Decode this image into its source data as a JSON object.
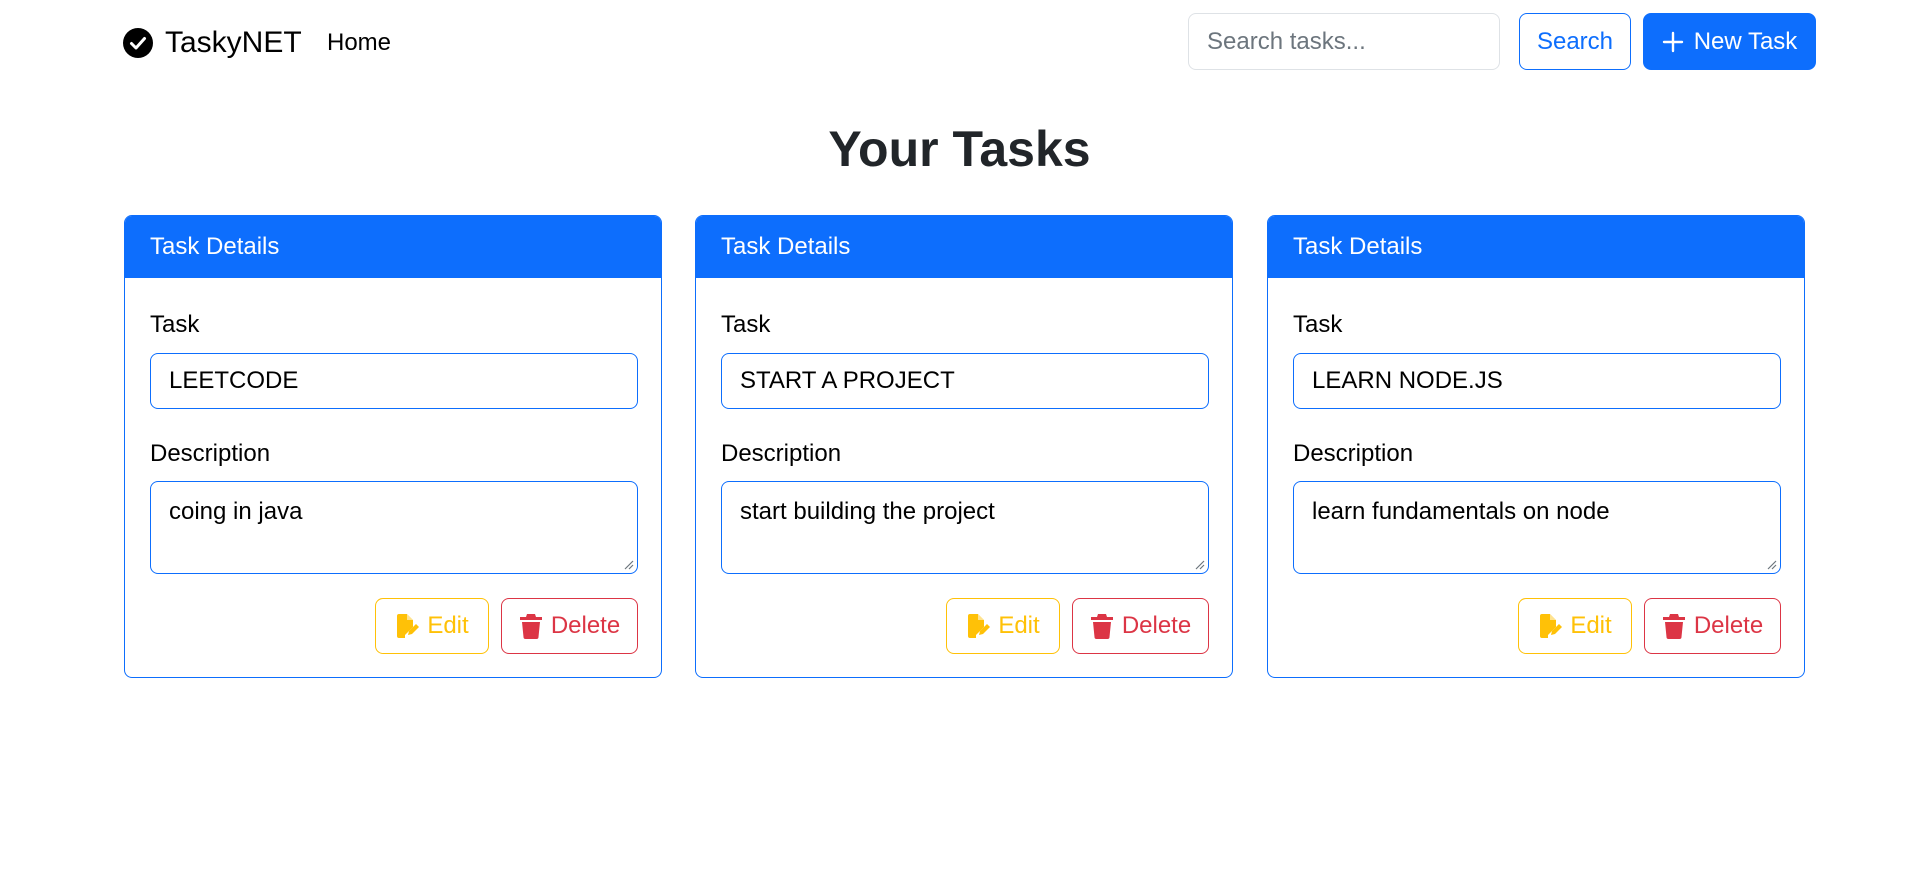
{
  "nav": {
    "brand": "TaskyNET",
    "home_link": "Home",
    "search_placeholder": "Search tasks...",
    "search_button": "Search",
    "new_task_button": "New Task"
  },
  "page": {
    "title": "Your Tasks"
  },
  "tasks": [
    {
      "header": "Task Details",
      "task_label": "Task",
      "task_value": "LEETCODE",
      "description_label": "Description",
      "description_value": "coing in java",
      "edit_label": "Edit",
      "delete_label": "Delete"
    },
    {
      "header": "Task Details",
      "task_label": "Task",
      "task_value": "START A PROJECT",
      "description_label": "Description",
      "description_value": "start building the project",
      "edit_label": "Edit",
      "delete_label": "Delete"
    },
    {
      "header": "Task Details",
      "task_label": "Task",
      "task_value": "LEARN NODE.JS",
      "description_label": "Description",
      "description_value": "learn fundamentals on node",
      "edit_label": "Edit",
      "delete_label": "Delete"
    }
  ],
  "colors": {
    "primary": "#0d6efd",
    "warning": "#ffc107",
    "danger": "#dc3545",
    "heading": "#212529"
  },
  "icons": {
    "brand": "check-circle-icon",
    "new_task": "plus-icon",
    "edit": "file-pen-icon",
    "delete": "trash-icon"
  }
}
